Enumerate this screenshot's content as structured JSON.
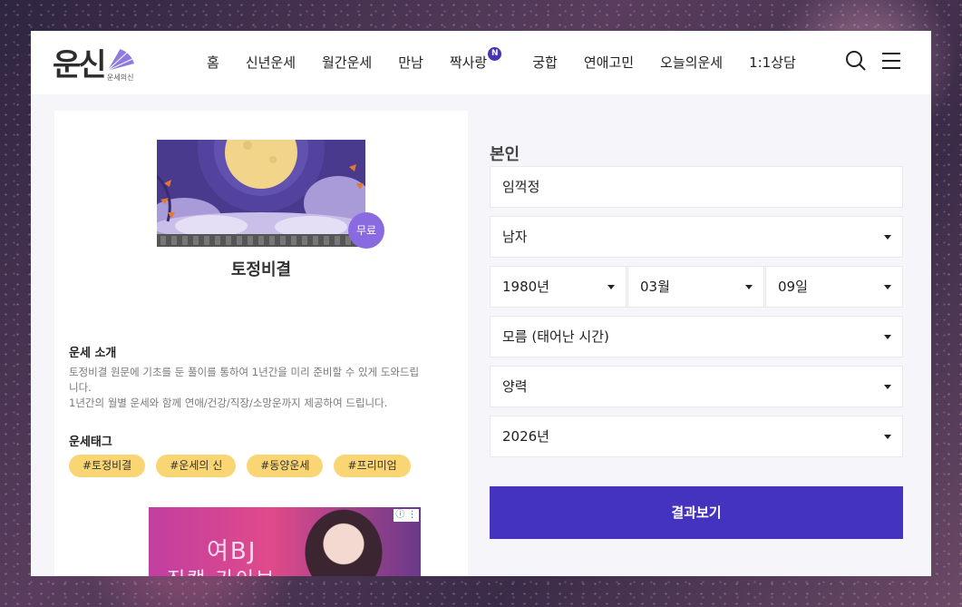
{
  "logo": {
    "main": "운신",
    "sub": "운세의신"
  },
  "nav": {
    "items": [
      "홈",
      "신년운세",
      "월간운세",
      "만남",
      "짝사랑",
      "궁합",
      "연애고민",
      "오늘의운세",
      "1:1상담"
    ],
    "badge": "N"
  },
  "header_icons": [
    "search-icon",
    "menu-icon"
  ],
  "card": {
    "free_badge": "무료",
    "title": "토정비결",
    "intro_title": "운세 소개",
    "intro_lines": [
      "토정비결 원문에 기초를 둔 풀이를 통하여 1년간을 미리 준비할 수 있게 도와드립",
      "니다.",
      "1년간의 월별 운세와 함께 연애/건강/직장/소망운까지 제공하여 드립니다."
    ],
    "tags_title": "운세태그",
    "tags": [
      "#토정비결",
      "#운세의 신",
      "#동양운세",
      "#프리미엄"
    ],
    "ad": {
      "line1": "여BJ",
      "line2": "직캠 가이브"
    }
  },
  "form": {
    "label": "본인",
    "name": "임꺽정",
    "gender": "남자",
    "year": "1980년",
    "month": "03월",
    "day": "09일",
    "time": "모름 (태어난 시간)",
    "calendar": "양력",
    "target_year": "2026년",
    "submit": "결과보기"
  },
  "colors": {
    "accent": "#4433bf",
    "tag": "#f9d573",
    "badge": "#8a6ae0"
  }
}
